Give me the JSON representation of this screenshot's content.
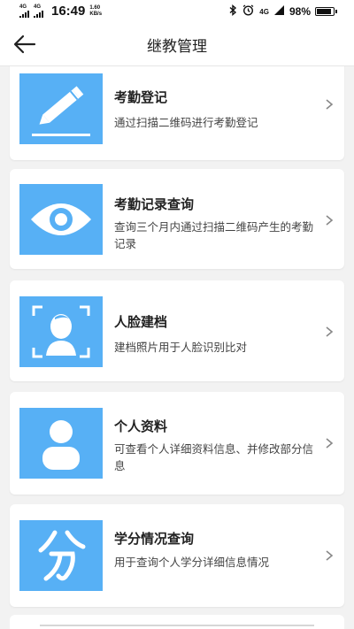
{
  "status_bar": {
    "network1": "4G",
    "network2": "4G",
    "time": "16:49",
    "speed_value": "1.60",
    "speed_unit": "KB/s",
    "signal_right": "4G",
    "battery_text": "98%",
    "battery_level": 0.98
  },
  "header": {
    "title": "继教管理"
  },
  "menu": [
    {
      "title": "考勤登记",
      "desc": "通过扫描二维码进行考勤登记",
      "icon": "pencil-icon"
    },
    {
      "title": "考勤记录查询",
      "desc": "查询三个月内通过扫描二维码产生的考勤记录",
      "icon": "eye-icon"
    },
    {
      "title": "人脸建档",
      "desc": "建档照片用于人脸识别比对",
      "icon": "face-scan-icon"
    },
    {
      "title": "个人资料",
      "desc": "可查看个人详细资料信息、并修改部分信息",
      "icon": "person-icon"
    },
    {
      "title": "学分情况查询",
      "desc": "用于查询个人学分详细信息情况",
      "icon": "credit-glyph-icon"
    }
  ],
  "colors": {
    "accent": "#57b0f5",
    "background": "#f2f2f2",
    "card": "#ffffff"
  }
}
